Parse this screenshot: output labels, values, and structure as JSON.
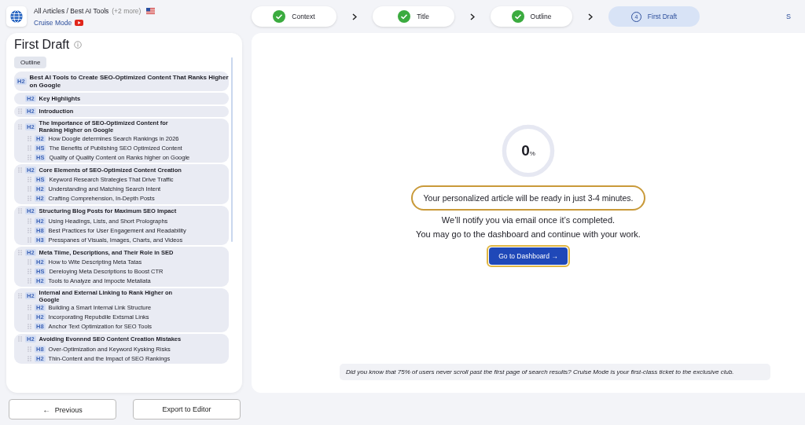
{
  "header": {
    "breadcrumb": "All Articles / Best AI Tools",
    "more": "(+2 more)",
    "mode_link": "Cruise Mode"
  },
  "steps": [
    {
      "label": "Context",
      "completed": true
    },
    {
      "label": "Title",
      "completed": true
    },
    {
      "label": "Outline",
      "completed": true
    },
    {
      "label": "First Draft",
      "completed": false,
      "number": "4"
    }
  ],
  "step_cut": "S",
  "panel": {
    "title": "First Draft",
    "tab": "Outline",
    "title_item": {
      "tag": "H2",
      "text": "Best AI Tools to Create SEO-Optimized Content That Ranks Higher on Google"
    },
    "sections": [
      {
        "tag": "H2",
        "text": "Key Highlights",
        "draggable": false
      },
      {
        "tag": "H2",
        "text": "Introduction",
        "draggable": true
      },
      {
        "tag": "H2",
        "text": "The Importance of SEO-Optimized Content for Ranking Higher on Google",
        "draggable": true,
        "children": [
          {
            "tag": "H2",
            "text": "How Doogle determines Search Rankings in 2026"
          },
          {
            "tag": "HS",
            "text": "The Benefits of Publishing SEO Optimized Content"
          },
          {
            "tag": "HS",
            "text": "Quality of Quality Content on Ranks higher on Google"
          }
        ]
      },
      {
        "tag": "H2",
        "text": "Core Elements of SEO-Optimized Content Creation",
        "draggable": true,
        "children": [
          {
            "tag": "HS",
            "text": "Keyword Research Strategies That Drive Traffic"
          },
          {
            "tag": "H2",
            "text": "Understanding and Matching Search Intent"
          },
          {
            "tag": "H2",
            "text": "Crafting Comprehension, In-Depth Posts"
          }
        ]
      },
      {
        "tag": "H2",
        "text": "Structuring Blog Posts for Maximum SEO Impact",
        "draggable": true,
        "children": [
          {
            "tag": "H2",
            "text": "Using Headings, Lists, and Short Prolographs"
          },
          {
            "tag": "H8",
            "text": "Best Practices for User Engagement and Readability"
          },
          {
            "tag": "H3",
            "text": "Presspanes of Visuals, Images, Charts, and Videos"
          }
        ]
      },
      {
        "tag": "H2",
        "text": "Meta Tiime, Descriptions, and Their Role in SED",
        "draggable": true,
        "children": [
          {
            "tag": "H2",
            "text": "How to Wite Descripting Meta Tatas"
          },
          {
            "tag": "HS",
            "text": "Dereloying Meta Descriptions to Boost CTR"
          },
          {
            "tag": "H2",
            "text": "Tools to Analyze and Impocte Metaliata"
          }
        ]
      },
      {
        "tag": "H2",
        "text": "Internal and External Linking to Rank Higher on Google",
        "draggable": true,
        "children": [
          {
            "tag": "H2",
            "text": "Building a Smart Internal Link Structure"
          },
          {
            "tag": "H2",
            "text": "Incorporating Repubdile Extsmal Links"
          },
          {
            "tag": "H8",
            "text": "Anchor Text Optimization for SEO Tools"
          }
        ]
      },
      {
        "tag": "H2",
        "text": "Avoiding Evonnnd SEO Content Creation Mistakes",
        "draggable": true,
        "children": [
          {
            "tag": "H8",
            "text": "Over-Optimization and Keyword Kysking Risks"
          },
          {
            "tag": "H2",
            "text": "Thin-Content and the Impact of SEO Rankings"
          }
        ]
      }
    ]
  },
  "progress": {
    "value": "0",
    "unit": "%",
    "level": 0
  },
  "ready_note": "Your personalized article will be ready in just 3-4 minutes.",
  "notify_lines": [
    "We’ll notify you via email once it’s completed.",
    "You may go to the dashboard and continue with your work."
  ],
  "dashboard_button": "Go to Dashboard →",
  "tip": "Did you know that 75% of users never scroll past the first page of search results? Cruise Mode is your first-class ticket to the exclusive club.",
  "footer": {
    "previous_arrow": "←",
    "previous": "Previous",
    "export": "Export to Editor"
  }
}
